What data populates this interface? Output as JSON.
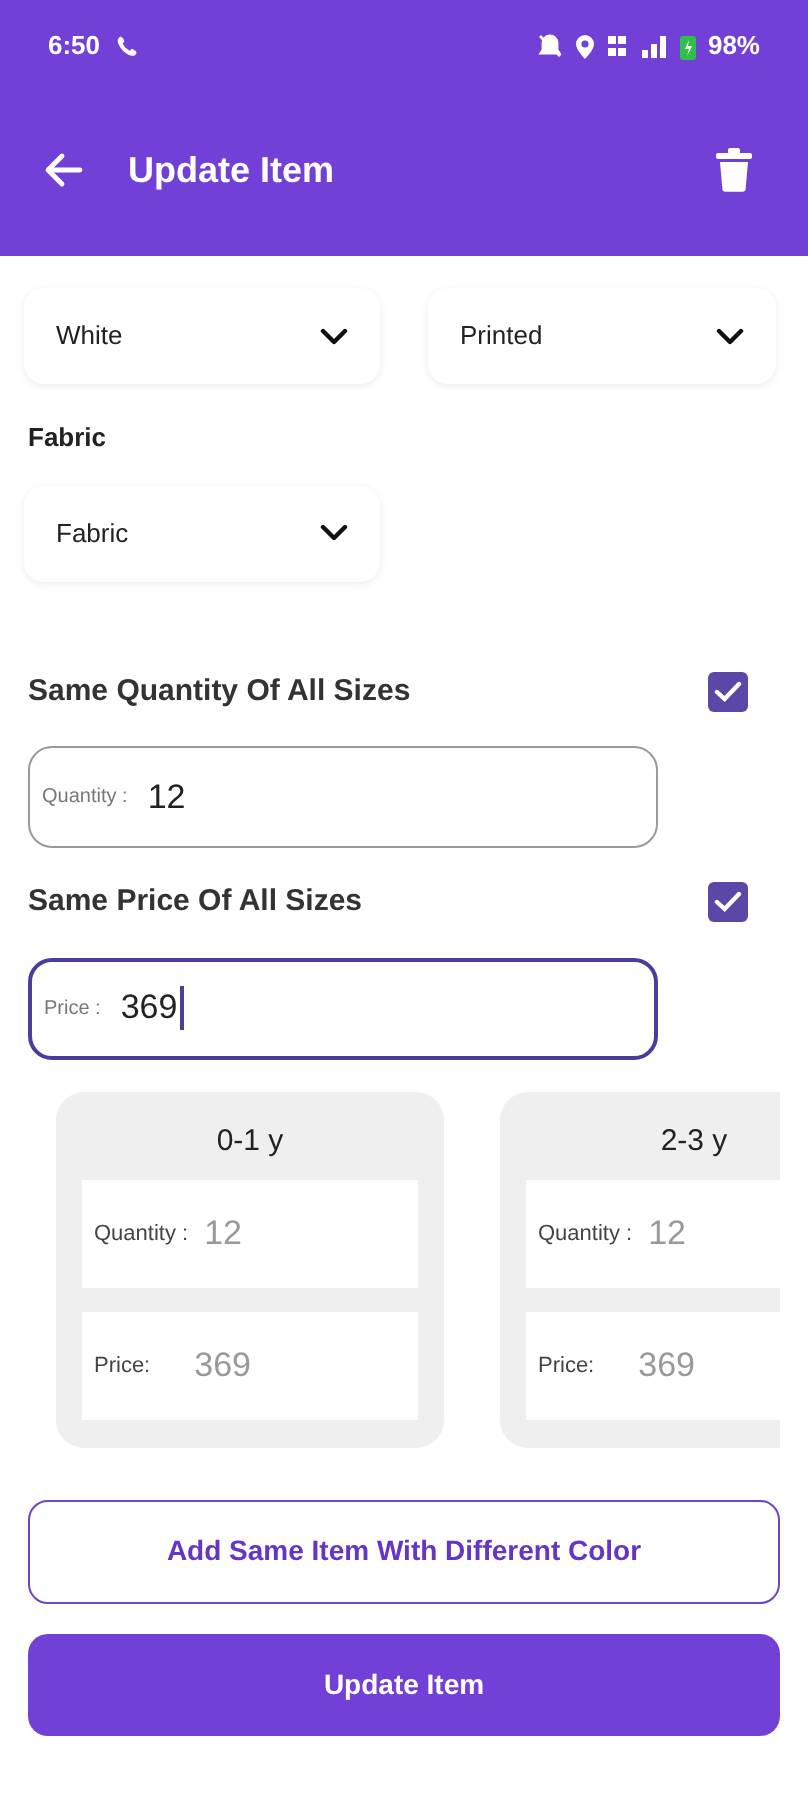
{
  "status_bar": {
    "time": "6:50",
    "battery": "98%"
  },
  "app_bar": {
    "title": "Update Item"
  },
  "dropdowns": [
    {
      "value": "White"
    },
    {
      "value": "Printed"
    }
  ],
  "fabric": {
    "label": "Fabric",
    "dropdown": {
      "value": "Fabric"
    }
  },
  "same_quantity": {
    "label": "Same Quantity Of All Sizes",
    "checked": true,
    "field": {
      "label": "Quantity :",
      "value": "12",
      "focused": false
    }
  },
  "same_price": {
    "label": "Same Price Of All Sizes",
    "checked": true,
    "field": {
      "label": "Price :",
      "value": "369",
      "focused": true
    }
  },
  "sizes": [
    {
      "title": "0-1 y",
      "quantity_label": "Quantity :",
      "quantity": "12",
      "price_label": "Price:",
      "price": "369"
    },
    {
      "title": "2-3 y",
      "quantity_label": "Quantity :",
      "quantity": "12",
      "price_label": "Price:",
      "price": "369"
    }
  ],
  "buttons": {
    "secondary": "Add Same Item With Different Color",
    "primary": "Update Item"
  }
}
